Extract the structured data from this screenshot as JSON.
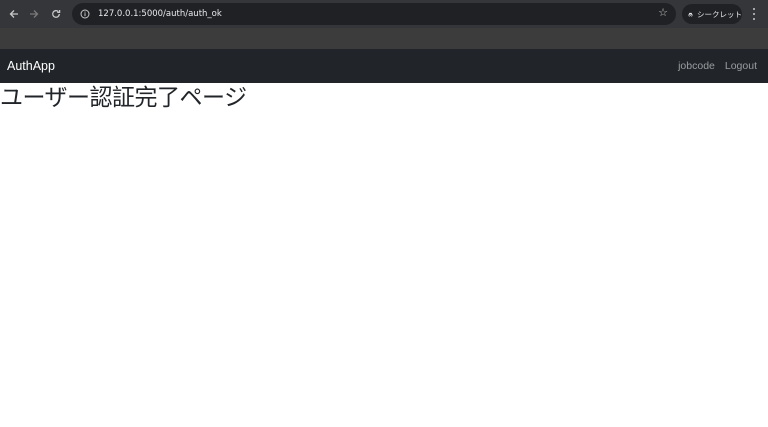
{
  "browser": {
    "url": "127.0.0.1:5000/auth/auth_ok",
    "incognito_label": "シークレット",
    "icons": {
      "back": "arrow-left-icon",
      "forward": "arrow-right-icon",
      "reload": "reload-icon",
      "site_info": "info-icon",
      "bookmark": "star-icon",
      "incognito": "incognito-icon",
      "menu": "more-vert-icon"
    }
  },
  "navbar": {
    "brand": "AuthApp",
    "links": [
      "jobcode",
      "Logout"
    ],
    "background": "#212529"
  },
  "main": {
    "title": "ユーザー認証完了ページ"
  }
}
